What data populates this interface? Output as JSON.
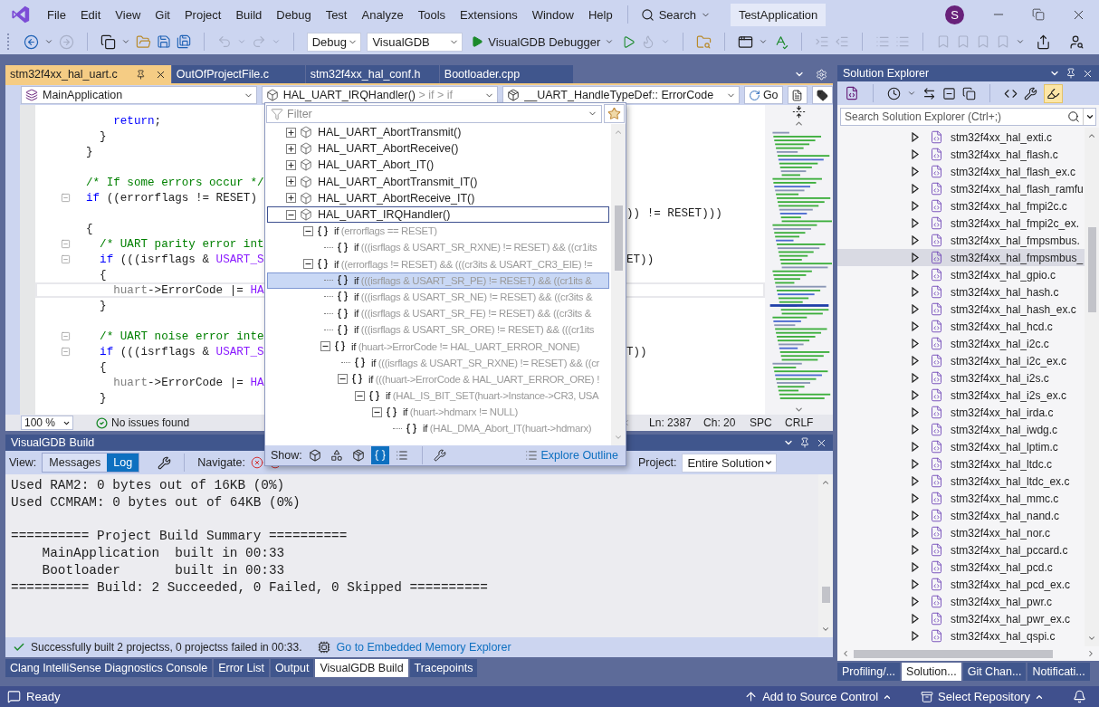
{
  "menu": {
    "items": [
      "File",
      "Edit",
      "View",
      "Git",
      "Project",
      "Build",
      "Debug",
      "Test",
      "Analyze",
      "Tools",
      "Extensions",
      "Window",
      "Help"
    ],
    "search": "Search",
    "solution": "TestApplication",
    "avatar": "S"
  },
  "toolbar": {
    "configuration": "Debug",
    "platform": "VisualGDB",
    "debugger": "VisualGDB Debugger"
  },
  "editor": {
    "tabs": [
      {
        "label": "stm32f4xx_hal_uart.c",
        "selected": true
      },
      {
        "label": "OutOfProjectFile.c",
        "selected": false
      },
      {
        "label": "stm32f4xx_hal_conf.h",
        "selected": false
      },
      {
        "label": "Bootloader.cpp",
        "selected": false
      }
    ],
    "navigation": {
      "project": "MainApplication",
      "scope": "HAL_UART_IRQHandler()",
      "scope_path": "> if > if",
      "member": "__UART_HandleTypeDef:: ErrorCode",
      "go": "Go"
    },
    "lines": [
      {
        "fold": false,
        "current": false,
        "segments": [
          {
            "text": "    return",
            "kind": "keyword"
          },
          {
            "text": ";",
            "kind": "plain"
          }
        ]
      },
      {
        "fold": false,
        "current": false,
        "segments": [
          {
            "text": "  }",
            "kind": "plain"
          }
        ]
      },
      {
        "fold": false,
        "current": false,
        "segments": [
          {
            "text": "}",
            "kind": "plain"
          }
        ]
      },
      {
        "fold": false,
        "current": false
      },
      {
        "fold": false,
        "current": false,
        "segments": [
          {
            "text": "/* If some errors occur */",
            "kind": "comment"
          }
        ]
      },
      {
        "fold": true,
        "current": false,
        "segments": [
          {
            "text": "if",
            "kind": "keyword"
          },
          {
            "text": " ((errorflags != RESET)",
            "kind": "plain"
          }
        ]
      },
      {
        "fold": false,
        "current": false,
        "tail": ")) != RESET)))"
      },
      {
        "fold": false,
        "current": false,
        "segments": [
          {
            "text": "{",
            "kind": "plain"
          }
        ]
      },
      {
        "fold": true,
        "current": false,
        "segments": [
          {
            "text": "  /* UART parity error int",
            "kind": "comment"
          }
        ]
      },
      {
        "fold": true,
        "current": false,
        "segments": [
          {
            "text": "  if",
            "kind": "keyword"
          },
          {
            "text": " (((isrflags & ",
            "kind": "plain"
          },
          {
            "text": "USART_S",
            "kind": "macro"
          }
        ],
        "tail": "ET))"
      },
      {
        "fold": false,
        "current": false,
        "segments": [
          {
            "text": "  {",
            "kind": "plain"
          }
        ]
      },
      {
        "fold": false,
        "current": true,
        "segments": [
          {
            "text": "    huart",
            "kind": "param"
          },
          {
            "text": "->ErrorCode |= ",
            "kind": "plain"
          },
          {
            "text": "HA",
            "kind": "macro"
          }
        ]
      },
      {
        "fold": false,
        "current": false,
        "segments": [
          {
            "text": "  }",
            "kind": "plain"
          }
        ]
      },
      {
        "fold": false,
        "current": false
      },
      {
        "fold": true,
        "current": false,
        "segments": [
          {
            "text": "  /* UART noise error inte",
            "kind": "comment"
          }
        ]
      },
      {
        "fold": true,
        "current": false,
        "segments": [
          {
            "text": "  if",
            "kind": "keyword"
          },
          {
            "text": " (((isrflags & ",
            "kind": "plain"
          },
          {
            "text": "USART_S",
            "kind": "macro"
          }
        ],
        "tail": "T))"
      },
      {
        "fold": false,
        "current": false,
        "segments": [
          {
            "text": "  {",
            "kind": "plain"
          }
        ]
      },
      {
        "fold": false,
        "current": false,
        "segments": [
          {
            "text": "    huart",
            "kind": "param"
          },
          {
            "text": "->ErrorCode |= ",
            "kind": "plain"
          },
          {
            "text": "HA",
            "kind": "macro"
          }
        ]
      },
      {
        "fold": false,
        "current": false,
        "segments": [
          {
            "text": "  }",
            "kind": "plain"
          }
        ]
      }
    ],
    "status": {
      "zoom": "100 %",
      "issues": "No issues found",
      "line": "Ln: 2387",
      "column": "Ch: 20",
      "whitespace": "SPC",
      "line_endings": "CRLF"
    }
  },
  "outline": {
    "filter_placeholder": "Filter",
    "items": [
      {
        "kind": "function",
        "label": "HAL_UART_AbortTransmit()",
        "expanded": false,
        "selected": false,
        "current": false
      },
      {
        "kind": "function",
        "label": "HAL_UART_AbortReceive()",
        "expanded": false,
        "selected": false,
        "current": false
      },
      {
        "kind": "function",
        "label": "HAL_UART_Abort_IT()",
        "expanded": false,
        "selected": false,
        "current": false
      },
      {
        "kind": "function",
        "label": "HAL_UART_AbortTransmit_IT()",
        "expanded": false,
        "selected": false,
        "current": false
      },
      {
        "kind": "function",
        "label": "HAL_UART_AbortReceive_IT()",
        "expanded": false,
        "selected": false,
        "current": false
      },
      {
        "kind": "function",
        "label": "HAL_UART_IRQHandler()",
        "expanded": true,
        "selected": false,
        "current": true,
        "children": [
          {
            "kind": "branch",
            "keyword": "if",
            "label": "(errorflags == RESET)",
            "expanded": true,
            "selected": false,
            "current": false,
            "children": [
              {
                "kind": "leaf",
                "keyword": "if",
                "label": "(((isrflags & USART_SR_RXNE) != RESET) && ((cr1its",
                "selected": false,
                "current": false
              }
            ]
          },
          {
            "kind": "branch",
            "keyword": "if",
            "label": "((errorflags != RESET) && (((cr3its & USART_CR3_EIE) !=",
            "expanded": true,
            "selected": false,
            "current": false,
            "children": [
              {
                "kind": "leaf",
                "keyword": "if",
                "label": "(((isrflags & USART_SR_PE) != RESET) && ((cr1its &",
                "selected": true,
                "current": false
              },
              {
                "kind": "leaf",
                "keyword": "if",
                "label": "(((isrflags & USART_SR_NE) != RESET) && ((cr3its &",
                "selected": false,
                "current": false
              },
              {
                "kind": "leaf",
                "keyword": "if",
                "label": "(((isrflags & USART_SR_FE) != RESET) && ((cr3its &",
                "selected": false,
                "current": false
              },
              {
                "kind": "leaf",
                "keyword": "if",
                "label": "(((isrflags & USART_SR_ORE) != RESET) && (((cr1its",
                "selected": false,
                "current": false
              },
              {
                "kind": "branch",
                "keyword": "if",
                "label": "(huart->ErrorCode != HAL_UART_ERROR_NONE)",
                "expanded": true,
                "selected": false,
                "current": false,
                "children": [
                  {
                    "kind": "leaf",
                    "keyword": "if",
                    "label": "(((isrflags & USART_SR_RXNE) != RESET) && ((cr",
                    "selected": false,
                    "current": false
                  },
                  {
                    "kind": "branch",
                    "keyword": "if",
                    "label": "(((huart->ErrorCode & HAL_UART_ERROR_ORE) !",
                    "expanded": true,
                    "selected": false,
                    "current": false,
                    "children": [
                      {
                        "kind": "branch",
                        "keyword": "if",
                        "label": "(HAL_IS_BIT_SET(huart->Instance->CR3, USA",
                        "expanded": true,
                        "selected": false,
                        "current": false,
                        "children": [
                          {
                            "kind": "branch",
                            "keyword": "if",
                            "label": "(huart->hdmarx != NULL)",
                            "expanded": true,
                            "selected": false,
                            "current": false,
                            "children": [
                              {
                                "kind": "leaf",
                                "keyword": "if",
                                "label": "(HAL_DMA_Abort_IT(huart->hdmarx)",
                                "selected": false,
                                "current": false
                              }
                            ]
                          }
                        ]
                      }
                    ]
                  }
                ]
              }
            ]
          }
        ]
      }
    ],
    "show_label": "Show:",
    "filters": [
      {
        "selected": false
      },
      {
        "selected": false
      },
      {
        "selected": false
      },
      {
        "selected": true
      },
      {
        "selected": false
      }
    ],
    "explore": "Explore Outline"
  },
  "build": {
    "title": "VisualGDB Build",
    "view_label": "View:",
    "views": [
      {
        "label": "Messages",
        "selected": false
      },
      {
        "label": "Log",
        "selected": true
      }
    ],
    "navigate_label": "Navigate:",
    "project_label": "Project:",
    "project": "Entire Solution",
    "log": [
      [
        "Used RAM2: 0 bytes out of 16KB (0%)",
        "Used CCMRAM: 0 bytes out of 64KB (0%)"
      ],
      [
        "========== Project Build Summary ==========",
        "    MainApplication  built in 00:33",
        "    Bootloader       built in 00:33",
        "========== Build: 2 Succeeded, 0 Failed, 0 Skipped =========="
      ]
    ],
    "result": "Successfully built 2 projectss, 0 projectss failed in 00:33.",
    "memory_link": "Go to Embedded Memory Explorer",
    "tabs": [
      {
        "label": "Clang IntelliSense Diagnostics Console",
        "selected": false
      },
      {
        "label": "Error List",
        "selected": false
      },
      {
        "label": "Output",
        "selected": false
      },
      {
        "label": "VisualGDB Build",
        "selected": true
      },
      {
        "label": "Tracepoints",
        "selected": false
      }
    ]
  },
  "solution_explorer": {
    "title": "Solution Explorer",
    "search_placeholder": "Search Solution Explorer (Ctrl+;)",
    "files": [
      {
        "name": "stm32f4xx_hal_exti.c",
        "selected": false
      },
      {
        "name": "stm32f4xx_hal_flash.c",
        "selected": false
      },
      {
        "name": "stm32f4xx_hal_flash_ex.c",
        "selected": false
      },
      {
        "name": "stm32f4xx_hal_flash_ramfu",
        "selected": false
      },
      {
        "name": "stm32f4xx_hal_fmpi2c.c",
        "selected": false
      },
      {
        "name": "stm32f4xx_hal_fmpi2c_ex.",
        "selected": false
      },
      {
        "name": "stm32f4xx_hal_fmpsmbus.",
        "selected": false
      },
      {
        "name": "stm32f4xx_hal_fmpsmbus_",
        "selected": true
      },
      {
        "name": "stm32f4xx_hal_gpio.c",
        "selected": false
      },
      {
        "name": "stm32f4xx_hal_hash.c",
        "selected": false
      },
      {
        "name": "stm32f4xx_hal_hash_ex.c",
        "selected": false
      },
      {
        "name": "stm32f4xx_hal_hcd.c",
        "selected": false
      },
      {
        "name": "stm32f4xx_hal_i2c.c",
        "selected": false
      },
      {
        "name": "stm32f4xx_hal_i2c_ex.c",
        "selected": false
      },
      {
        "name": "stm32f4xx_hal_i2s.c",
        "selected": false
      },
      {
        "name": "stm32f4xx_hal_i2s_ex.c",
        "selected": false
      },
      {
        "name": "stm32f4xx_hal_irda.c",
        "selected": false
      },
      {
        "name": "stm32f4xx_hal_iwdg.c",
        "selected": false
      },
      {
        "name": "stm32f4xx_hal_lptim.c",
        "selected": false
      },
      {
        "name": "stm32f4xx_hal_ltdc.c",
        "selected": false
      },
      {
        "name": "stm32f4xx_hal_ltdc_ex.c",
        "selected": false
      },
      {
        "name": "stm32f4xx_hal_mmc.c",
        "selected": false
      },
      {
        "name": "stm32f4xx_hal_nand.c",
        "selected": false
      },
      {
        "name": "stm32f4xx_hal_nor.c",
        "selected": false
      },
      {
        "name": "stm32f4xx_hal_pccard.c",
        "selected": false
      },
      {
        "name": "stm32f4xx_hal_pcd.c",
        "selected": false
      },
      {
        "name": "stm32f4xx_hal_pcd_ex.c",
        "selected": false
      },
      {
        "name": "stm32f4xx_hal_pwr.c",
        "selected": false
      },
      {
        "name": "stm32f4xx_hal_pwr_ex.c",
        "selected": false
      },
      {
        "name": "stm32f4xx_hal_qspi.c",
        "selected": false
      }
    ],
    "tabs": [
      {
        "label": "Profiling/...",
        "selected": false
      },
      {
        "label": "Solution...",
        "selected": true
      },
      {
        "label": "Git Chan...",
        "selected": false
      },
      {
        "label": "Notificati...",
        "selected": false
      }
    ]
  },
  "status_bar": {
    "message": "Ready",
    "source_control": "Add to Source Control",
    "repository": "Select Repository"
  }
}
